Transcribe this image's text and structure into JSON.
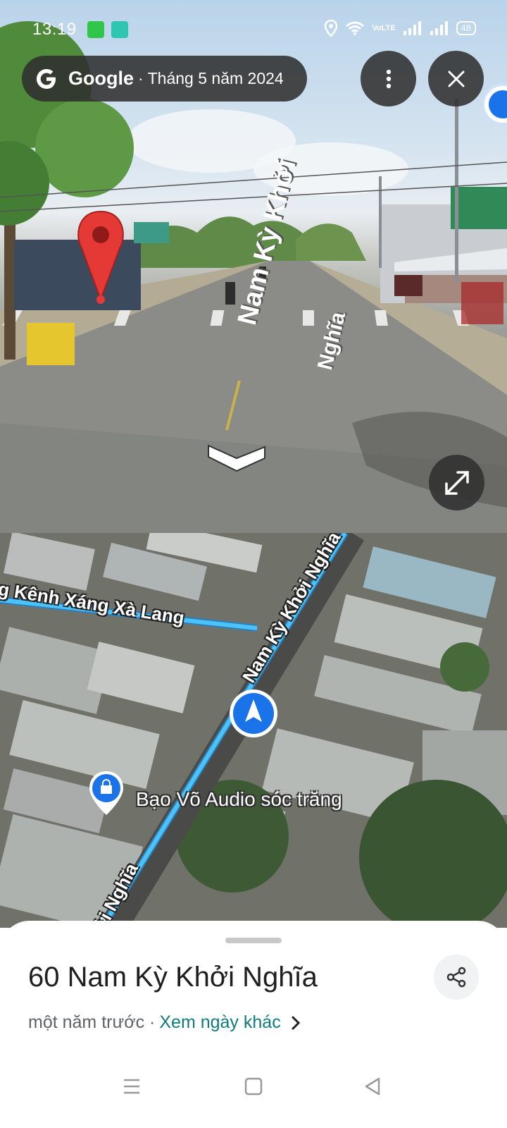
{
  "status_bar": {
    "time": "13:19",
    "network_text": "VoLTE",
    "battery": "48"
  },
  "source_pill": {
    "brand": "Google",
    "date": "· Tháng 5 năm 2024"
  },
  "street_view": {
    "road_label_line1": "Nam Kỳ Khởi",
    "road_label_line2": "Nghĩa"
  },
  "map": {
    "street_1": "g Kênh Xáng Xà Lang",
    "street_2": "Nam Kỳ Khởi Nghĩa",
    "street_3": "ởi Nghĩa",
    "poi": "Bạo Võ Audio sóc trăng",
    "route_color": "#27a8ec"
  },
  "place": {
    "title": "60 Nam Kỳ Khởi Nghĩa",
    "age": "một năm trước ·",
    "other_dates_link": "Xem ngày khác"
  },
  "colors": {
    "accent_link": "#0f7b7e",
    "pin_red": "#e53935",
    "location_blue": "#1a73e8"
  }
}
